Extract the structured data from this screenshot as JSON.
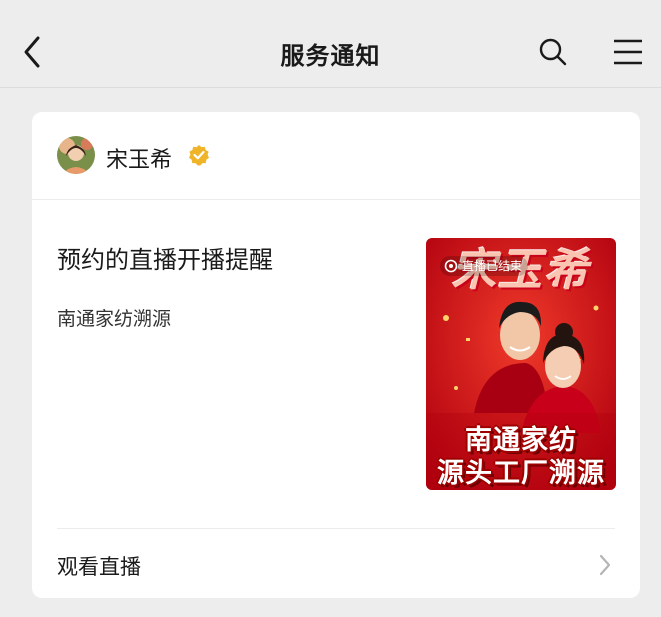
{
  "nav": {
    "title": "服务通知",
    "back_icon": "chevron-left-icon",
    "search_icon": "search-icon",
    "menu_icon": "hamburger-menu-icon"
  },
  "card": {
    "account": {
      "name": "宋玉希",
      "verified_icon": "verified-badge-icon",
      "verified_color": "#f0b429"
    },
    "title": "预约的直播开播提醒",
    "subtitle": "南通家纺溯源",
    "cover": {
      "status": "直播已结束",
      "brand": "宋玉希",
      "line1": "南通家纺",
      "line2": "源头工厂溯源",
      "bg_color": "#d0101e"
    },
    "action": {
      "label": "观看直播",
      "icon": "chevron-right-icon"
    }
  }
}
